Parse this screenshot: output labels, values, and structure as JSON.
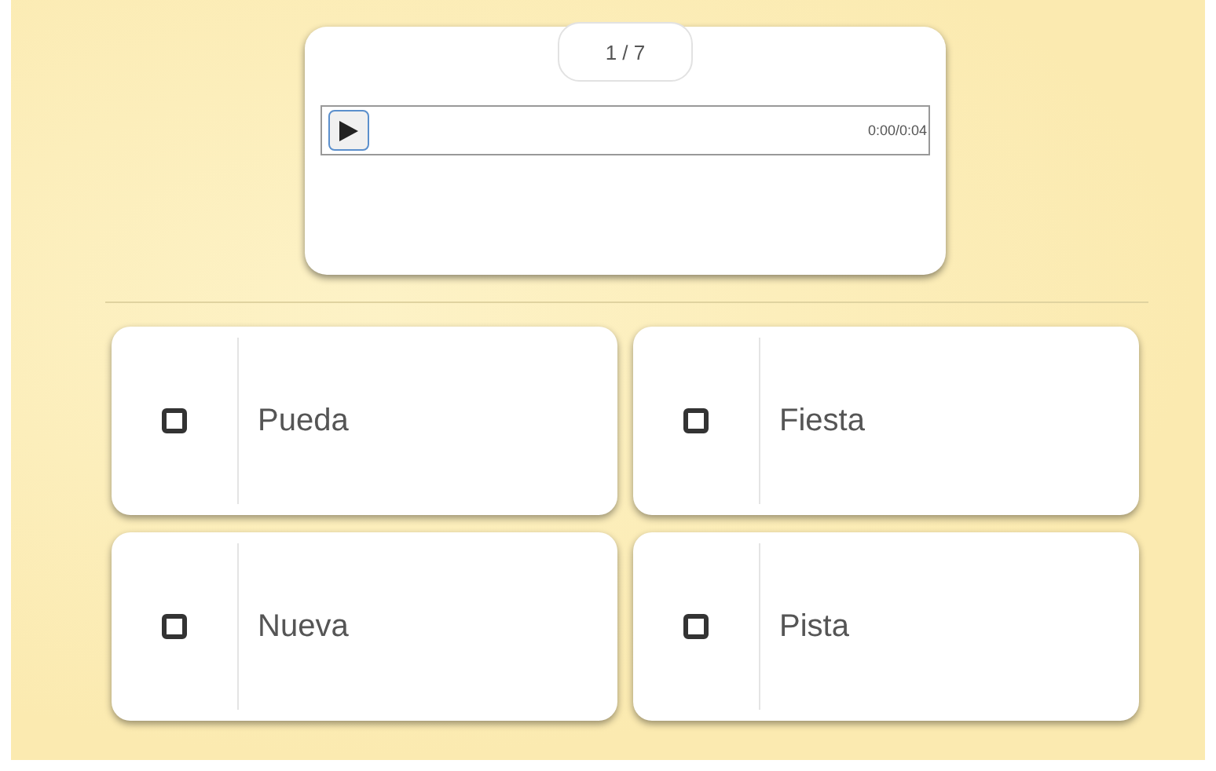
{
  "counter": "1 / 7",
  "audio": {
    "playing": false,
    "time": "0:00/0:04"
  },
  "answers": [
    {
      "label": "Pueda",
      "checked": false
    },
    {
      "label": "Fiesta",
      "checked": false
    },
    {
      "label": "Nueva",
      "checked": false
    },
    {
      "label": "Pista",
      "checked": false
    }
  ]
}
